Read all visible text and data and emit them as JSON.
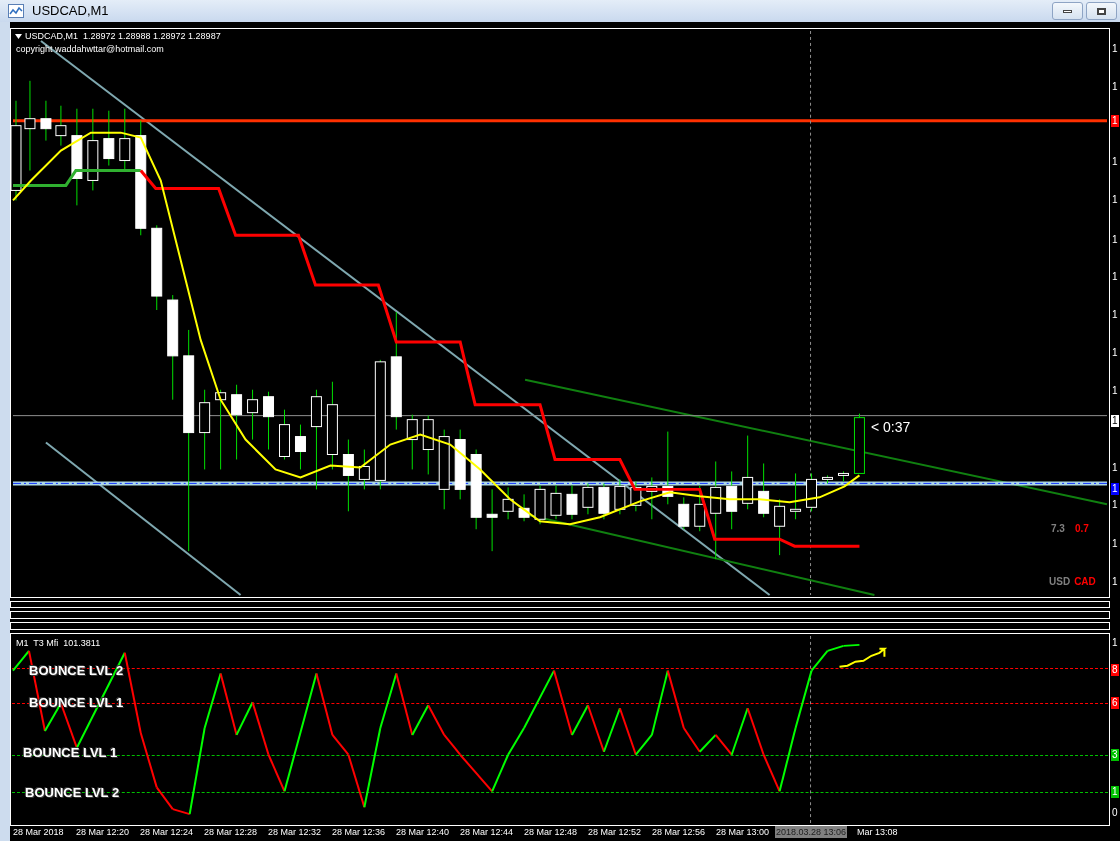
{
  "window": {
    "title": "USDCAD,M1",
    "buttons": [
      {
        "kind": "minimize"
      },
      {
        "kind": "maximize"
      }
    ]
  },
  "chart": {
    "header": "USDCAD,M1  1.28972 1.28988 1.28972 1.28987",
    "copyright": "copyright waddahwttar@hotmail.com",
    "countdown": "< 0:37",
    "strength": [
      {
        "text": "7.3",
        "color": "#808080"
      },
      {
        "text": "0.7",
        "color": "#ff0000"
      }
    ],
    "pair": [
      {
        "text": "USD",
        "color": "#808080"
      },
      {
        "text": "CAD",
        "color": "#ff0000"
      }
    ],
    "price_axis": [
      {
        "text": "1",
        "kind": "tick"
      },
      {
        "text": "1",
        "kind": "tick"
      },
      {
        "text": "1",
        "kind": "tag",
        "color": "#ff0000"
      },
      {
        "text": "1",
        "kind": "tick"
      },
      {
        "text": "1",
        "kind": "tick"
      },
      {
        "text": "1",
        "kind": "tick"
      },
      {
        "text": "1",
        "kind": "tick"
      },
      {
        "text": "1",
        "kind": "tick"
      },
      {
        "text": "1",
        "kind": "tick"
      },
      {
        "text": "1",
        "kind": "tick"
      },
      {
        "text": "1",
        "kind": "tag",
        "color": "#ffffff"
      },
      {
        "text": "1",
        "kind": "tick"
      },
      {
        "text": "1",
        "kind": "tag",
        "color": "#0000ff"
      },
      {
        "text": "1",
        "kind": "tick"
      },
      {
        "text": "1",
        "kind": "tick"
      },
      {
        "text": "1",
        "kind": "tick"
      }
    ]
  },
  "indicator": {
    "header": "M1  T3 Mfi  101.3811",
    "levels": [
      {
        "text": "BOUNCE LVL 2",
        "color": "#ff0000"
      },
      {
        "text": "BOUNCE LVL 1",
        "color": "#ff0000"
      },
      {
        "text": "BOUNCE LVL 1",
        "color": "#00c000"
      },
      {
        "text": "BOUNCE LVL 2",
        "color": "#00c000"
      }
    ],
    "axis": [
      {
        "text": "1",
        "kind": "tick"
      },
      {
        "text": "8",
        "kind": "tag",
        "color": "#ff0000"
      },
      {
        "text": "6",
        "kind": "tag",
        "color": "#ff0000"
      },
      {
        "text": "3",
        "kind": "tag",
        "color": "#00c000"
      },
      {
        "text": "1",
        "kind": "tag",
        "color": "#00c000"
      },
      {
        "text": "0",
        "kind": "tick"
      }
    ]
  },
  "time_axis": [
    {
      "text": "28 Mar 2018",
      "kind": "tick"
    },
    {
      "text": "28 Mar 12:20",
      "kind": "tick"
    },
    {
      "text": "28 Mar 12:24",
      "kind": "tick"
    },
    {
      "text": "28 Mar 12:28",
      "kind": "tick"
    },
    {
      "text": "28 Mar 12:32",
      "kind": "tick"
    },
    {
      "text": "28 Mar 12:36",
      "kind": "tick"
    },
    {
      "text": "28 Mar 12:40",
      "kind": "tick"
    },
    {
      "text": "28 Mar 12:44",
      "kind": "tick"
    },
    {
      "text": "28 Mar 12:48",
      "kind": "tick"
    },
    {
      "text": "28 Mar 12:52",
      "kind": "tick"
    },
    {
      "text": "28 Mar 12:56",
      "kind": "tick"
    },
    {
      "text": "28 Mar 13:00",
      "kind": "tick"
    },
    {
      "text": "2018.03.28 13:06",
      "kind": "cursor"
    },
    {
      "text": "Mar 13:08",
      "kind": "tick"
    }
  ]
}
